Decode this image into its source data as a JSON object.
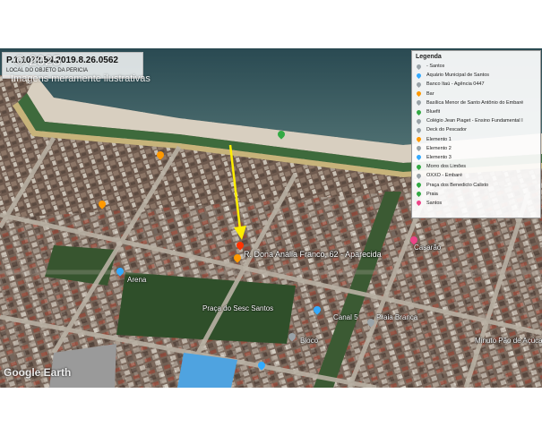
{
  "header": {
    "title": "P.1.1072.54.2019.8.26.0562",
    "subtitle": "LOCAL DO OBJETO DA PERICIA"
  },
  "copyright": "© 2025",
  "disclaimer": "Imagens meramente ilustrativas",
  "watermark": "Google Earth",
  "legend": {
    "title": "Legenda",
    "items": [
      {
        "label": "- Santos",
        "color": "#9aa3a8"
      },
      {
        "label": "Aquário Municipal de Santos",
        "color": "#33aaff"
      },
      {
        "label": "Banco Itaú - Agência 0447",
        "color": "#9aa3a8"
      },
      {
        "label": "Bar",
        "color": "#ff9900"
      },
      {
        "label": "Basílica Menor de Santo Antônio do Embaré",
        "color": "#9aa3a8"
      },
      {
        "label": "Bluefit",
        "color": "#33aa44"
      },
      {
        "label": "Colégio Jean Piaget - Ensino Fundamental I",
        "color": "#9aa3a8"
      },
      {
        "label": "Deck do Pescador",
        "color": "#9aa3a8"
      },
      {
        "label": "Elemento 1",
        "color": "#ff9900"
      },
      {
        "label": "Elemento 2",
        "color": "#9aa3a8"
      },
      {
        "label": "Elemento 3",
        "color": "#33aaff"
      },
      {
        "label": "Morro dos Limões",
        "color": "#33aa44"
      },
      {
        "label": "OXXO - Embaré",
        "color": "#9aa3a8"
      },
      {
        "label": "Praça dos Benedicto Calixto",
        "color": "#33aa44"
      },
      {
        "label": "Praia",
        "color": "#33aa44"
      },
      {
        "label": "Santos",
        "color": "#ee4488"
      }
    ]
  },
  "map_labels": {
    "address": "R. Dona Anália Franco, 62 - Aparecida",
    "praca": "Praça do Sesc Santos",
    "arena": "Arena",
    "casarao": "Casarão",
    "canal": "Canal 5",
    "praia_branca": "Praia Branca",
    "minuto": "Minuto Pão de Açúcar",
    "bloco": "Bloco"
  },
  "colors": {
    "arrow": "#ffee00",
    "marker": "#ff3300"
  }
}
